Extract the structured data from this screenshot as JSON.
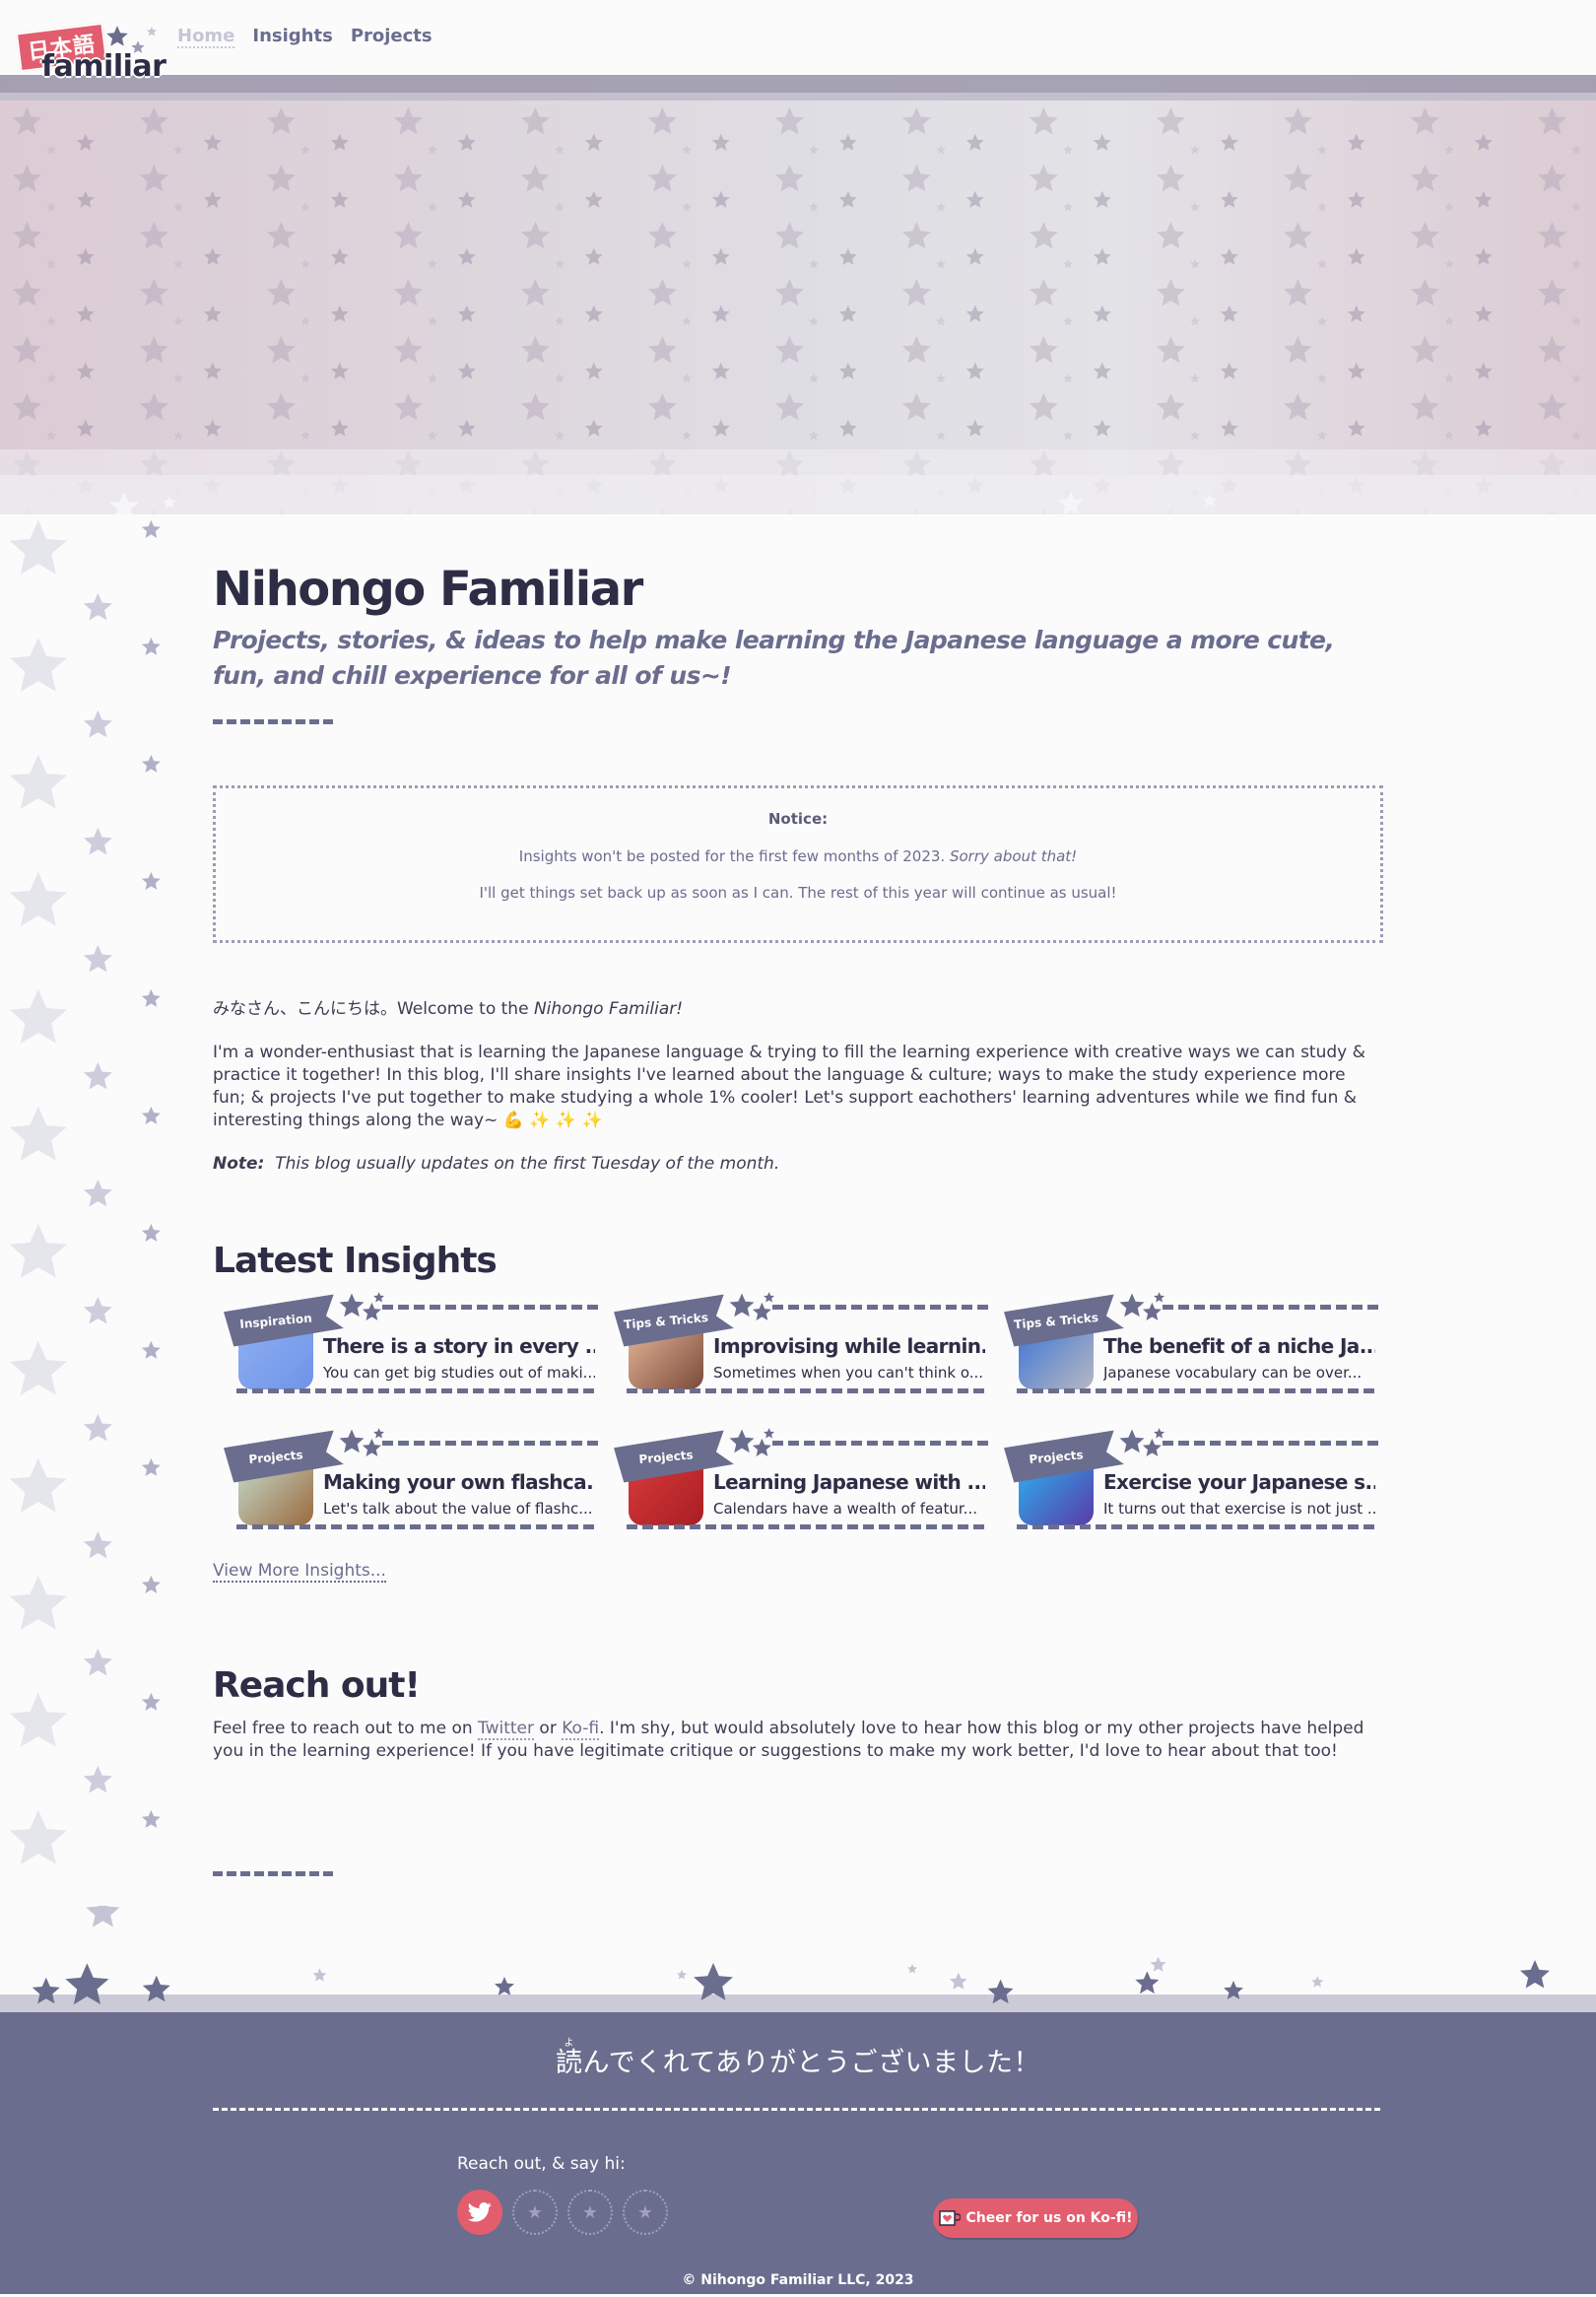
{
  "nav": {
    "logo_kanji": "日本語",
    "logo_word": "familiar",
    "links": [
      {
        "label": "Home",
        "active": true
      },
      {
        "label": "Insights",
        "active": false
      },
      {
        "label": "Projects",
        "active": false
      }
    ]
  },
  "header": {
    "title": "Nihongo Familiar",
    "tagline": "Projects, stories, & ideas to help make learning the Japanese language a more cute, fun, and chill experience for all of us~!"
  },
  "notice": {
    "title": "Notice:",
    "line1": "Insights won't be posted for the first few months of 2023.",
    "line1_em": "Sorry about that!",
    "line2": "I'll get things set back up as soon as I can. The rest of this year will continue as usual!"
  },
  "intro": {
    "greeting": "みなさん、こんにちは。Welcome to the ",
    "greeting_em": "Nihongo Familiar!",
    "body": "I'm a wonder-enthusiast that is learning the Japanese language & trying to fill the learning experience with creative ways we can study & practice it together! In this blog, I'll share insights I've learned about the language & culture; ways to make the study experience more fun; & projects I've put together to make studying a whole 1% cooler! Let's support eachothers' learning adventures while we find fun & interesting things along the way~ 💪 ✨ ✨ ✨",
    "note_label": "Note:",
    "note_text": "This blog usually updates on the first Tuesday of the month."
  },
  "insights": {
    "title": "Latest Insights",
    "cards": [
      {
        "category": "Inspiration",
        "title": "There is a story in every ...",
        "excerpt": "You can get big studies out of maki...",
        "thumb_colors": [
          "#8fb0f2",
          "#6f93e8"
        ]
      },
      {
        "category": "Tips & Tricks",
        "title": "Improvising while learnin...",
        "excerpt": "Sometimes when you can't think o...",
        "thumb_colors": [
          "#e8b89a",
          "#7a4a3a"
        ]
      },
      {
        "category": "Tips & Tricks",
        "title": "The benefit of a niche Ja...",
        "excerpt": "Japanese vocabulary can be over...",
        "thumb_colors": [
          "#3a74d8",
          "#b8b8c0"
        ]
      },
      {
        "category": "Projects",
        "title": "Making your own flashca...",
        "excerpt": "Let's talk about the value of flashc...",
        "thumb_colors": [
          "#c6dccf",
          "#9a6a3e"
        ]
      },
      {
        "category": "Projects",
        "title": "Learning Japanese with ...",
        "excerpt": "Calendars have a wealth of featur...",
        "thumb_colors": [
          "#d83a3a",
          "#a81e24"
        ]
      },
      {
        "category": "Projects",
        "title": "Exercise your Japanese s...",
        "excerpt": "It turns out that exercise is not just ...",
        "thumb_colors": [
          "#2ab4f0",
          "#5a3aa8"
        ]
      }
    ],
    "view_more": "View More Insights..."
  },
  "reach": {
    "title": "Reach out!",
    "text_before": "Feel free to reach out to me on ",
    "twitter": "Twitter",
    "or": " or ",
    "kofi": "Ko-fi",
    "text_after": ". I'm shy, but would absolutely love to hear how this blog or my other projects have helped you in the learning experience! If you have legitimate critique or suggestions to make my work better, I'd love to hear about that too!"
  },
  "footer": {
    "thanks_kanji": "読",
    "thanks_ruby": "よ",
    "thanks_rest": "んでくれてありがとうございました！",
    "reach_label": "Reach out, & say hi:",
    "socials": [
      {
        "icon": "twitter-icon",
        "active": true
      },
      {
        "icon": "star-icon",
        "active": false
      },
      {
        "icon": "star-icon",
        "active": false
      },
      {
        "icon": "star-icon",
        "active": false
      }
    ],
    "kofi_button": "Cheer for us on Ko-fi!",
    "copyright": "© Nihongo Familiar LLC, 2023"
  },
  "colors": {
    "accent": "#e25d6e",
    "primary": "#6b6d8e",
    "dark": "#2d2d45",
    "background": "#fbfbfc"
  }
}
